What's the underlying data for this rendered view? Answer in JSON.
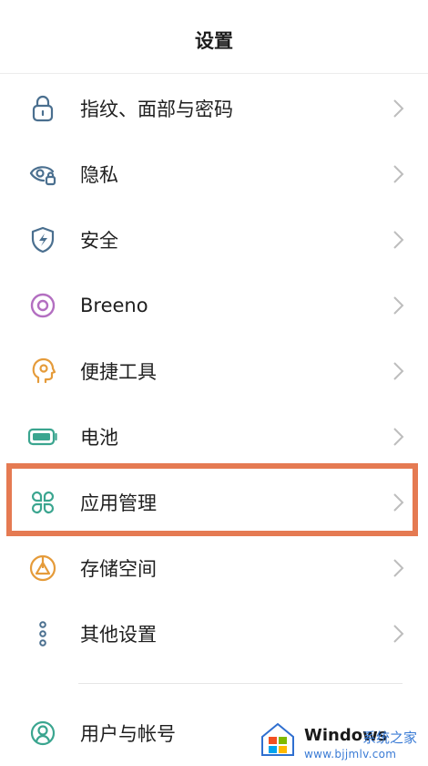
{
  "header": {
    "title": "设置"
  },
  "settings": [
    {
      "label": "指纹、面部与密码",
      "icon": "lock-icon"
    },
    {
      "label": "隐私",
      "icon": "eye-lock-icon"
    },
    {
      "label": "安全",
      "icon": "shield-bolt-icon"
    },
    {
      "label": "Breeno",
      "icon": "breeno-icon"
    },
    {
      "label": "便捷工具",
      "icon": "head-gear-icon"
    },
    {
      "label": "电池",
      "icon": "battery-icon"
    },
    {
      "label": "应用管理",
      "icon": "app-grid-icon",
      "highlighted": true
    },
    {
      "label": "存储空间",
      "icon": "pie-chart-icon"
    },
    {
      "label": "其他设置",
      "icon": "more-dots-icon"
    },
    {
      "label": "用户与帐号",
      "icon": "user-icon"
    }
  ],
  "watermark": {
    "brand": "Windows",
    "subtitle": "系统之家",
    "url": "www.bjjmlv.com"
  },
  "colors": {
    "highlight": "#e57a52",
    "icon_blue": "#4a6f8f",
    "icon_green": "#3aa58f",
    "icon_purple": "#b36fc1",
    "icon_orange": "#e59b3a",
    "chevron": "#bdbdbd"
  }
}
